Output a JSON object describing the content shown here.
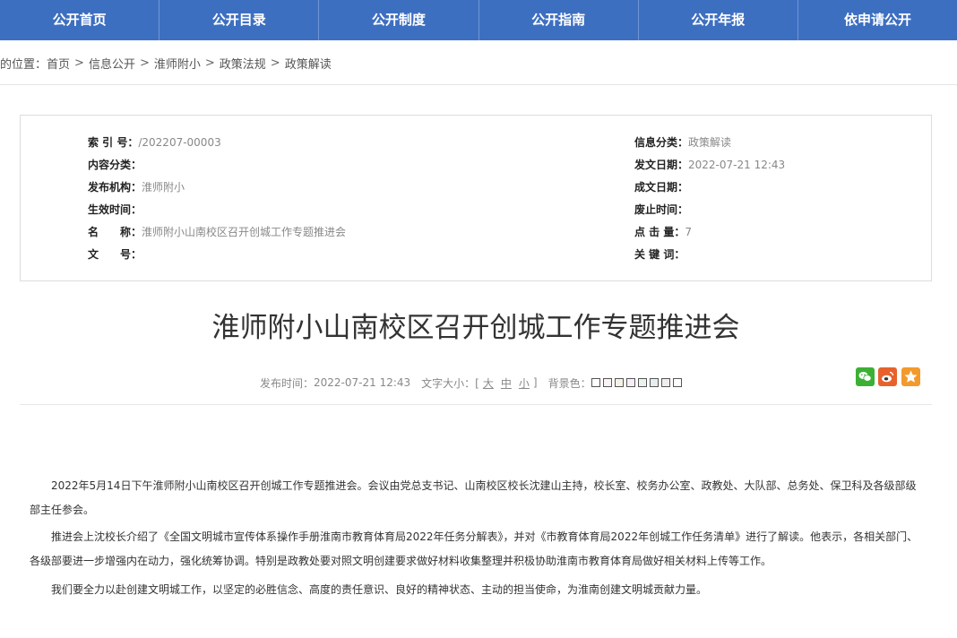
{
  "nav": {
    "items": [
      {
        "label": "公开首页"
      },
      {
        "label": "公开目录"
      },
      {
        "label": "公开制度"
      },
      {
        "label": "公开指南"
      },
      {
        "label": "公开年报"
      },
      {
        "label": "依申请公开"
      }
    ]
  },
  "breadcrumb": {
    "prefix": "的位置：",
    "sep": ">",
    "items": [
      "首页",
      "信息公开",
      "淮师附小",
      "政策法规",
      "政策解读"
    ]
  },
  "meta": {
    "left": [
      {
        "key": "索 引 号：",
        "value": "/202207-00003"
      },
      {
        "key": "内容分类：",
        "value": ""
      },
      {
        "key": "发布机构：",
        "value": "淮师附小"
      },
      {
        "key": "生效时间：",
        "value": ""
      },
      {
        "key": "名　　称：",
        "value": "淮师附小山南校区召开创城工作专题推进会"
      },
      {
        "key": "文　　号：",
        "value": ""
      }
    ],
    "right": [
      {
        "key": "信息分类：",
        "value": "政策解读"
      },
      {
        "key": "发文日期：",
        "value": "2022-07-21 12:43"
      },
      {
        "key": "成文日期：",
        "value": ""
      },
      {
        "key": "废止时间：",
        "value": ""
      },
      {
        "key": "点 击 量：",
        "value": "7"
      },
      {
        "key": "关 键 词：",
        "value": ""
      }
    ]
  },
  "article": {
    "title": "淮师附小山南校区召开创城工作专题推进会",
    "publish_label": "发布时间：",
    "publish_time": "2022-07-21 12:43",
    "font_size_label": "文字大小：[",
    "font_size_options": [
      "大",
      "中",
      "小"
    ],
    "font_size_close": "]",
    "bg_label": "背景色：",
    "bg_colors": [
      "#ffffff",
      "#fbf3f3",
      "#f4f1e6",
      "#f6eef6",
      "#e9f2ed",
      "#e4efef",
      "#eeeeee",
      "#ffffff"
    ],
    "paragraphs": [
      "2022年5月14日下午淮师附小山南校区召开创城工作专题推进会。会议由党总支书记、山南校区校长沈建山主持，校长室、校务办公室、政教处、大队部、总务处、保卫科及各级部级部主任参会。",
      "推进会上沈校长介绍了《全国文明城市宣传体系操作手册淮南市教育体育局2022年任务分解表》，并对《市教育体育局2022年创城工作任务清单》进行了解读。他表示，各相关部门、各级部要进一步增强内在动力，强化统筹协调。特别是政教处要对照文明创建要求做好材料收集整理并积极协助淮南市教育体育局做好相关材料上传等工作。",
      "我们要全力以赴创建文明城工作，以坚定的必胜信念、高度的责任意识、良好的精神状态、主动的担当使命，为淮南创建文明城贡献力量。"
    ]
  },
  "share": {
    "icons": [
      {
        "name": "wechat-icon",
        "color": "#3cb035"
      },
      {
        "name": "weibo-icon",
        "color": "#e8612c"
      },
      {
        "name": "favorite-star-icon",
        "color": "#f39a2c"
      }
    ]
  }
}
